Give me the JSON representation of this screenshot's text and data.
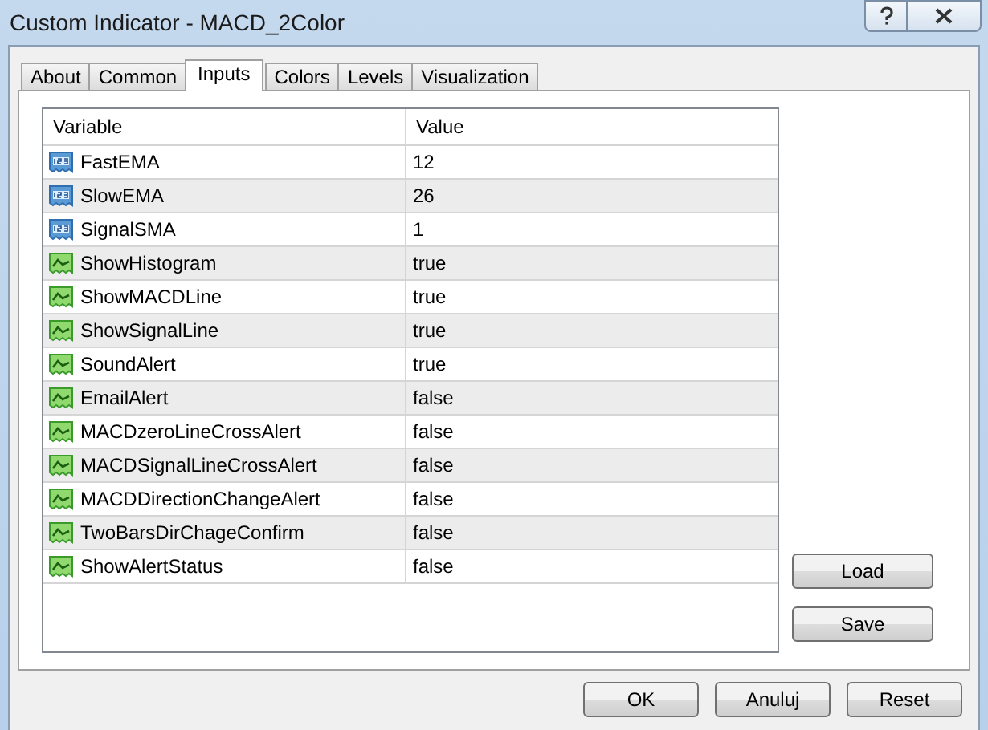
{
  "window": {
    "title": "Custom Indicator - MACD_2Color"
  },
  "tabs": [
    {
      "label": "About",
      "selected": false
    },
    {
      "label": "Common",
      "selected": false
    },
    {
      "label": "Inputs",
      "selected": true
    },
    {
      "label": "Colors",
      "selected": false
    },
    {
      "label": "Levels",
      "selected": false
    },
    {
      "label": "Visualization",
      "selected": false
    }
  ],
  "table": {
    "columns": [
      "Variable",
      "Value"
    ],
    "rows": [
      {
        "kind": "number",
        "variable": "FastEMA",
        "value": "12"
      },
      {
        "kind": "number",
        "variable": "SlowEMA",
        "value": "26"
      },
      {
        "kind": "number",
        "variable": "SignalSMA",
        "value": "1"
      },
      {
        "kind": "boolean",
        "variable": "ShowHistogram",
        "value": "true"
      },
      {
        "kind": "boolean",
        "variable": "ShowMACDLine",
        "value": "true"
      },
      {
        "kind": "boolean",
        "variable": "ShowSignalLine",
        "value": "true"
      },
      {
        "kind": "boolean",
        "variable": "SoundAlert",
        "value": "true"
      },
      {
        "kind": "boolean",
        "variable": "EmailAlert",
        "value": "false"
      },
      {
        "kind": "boolean",
        "variable": "MACDzeroLineCrossAlert",
        "value": "false"
      },
      {
        "kind": "boolean",
        "variable": "MACDSignalLineCrossAlert",
        "value": "false"
      },
      {
        "kind": "boolean",
        "variable": "MACDDirectionChangeAlert",
        "value": "false"
      },
      {
        "kind": "boolean",
        "variable": "TwoBarsDirChageConfirm",
        "value": "false"
      },
      {
        "kind": "boolean",
        "variable": "ShowAlertStatus",
        "value": "false"
      }
    ]
  },
  "side_buttons": [
    "Load",
    "Save"
  ],
  "buttons": [
    "OK",
    "Anuluj",
    "Reset"
  ]
}
